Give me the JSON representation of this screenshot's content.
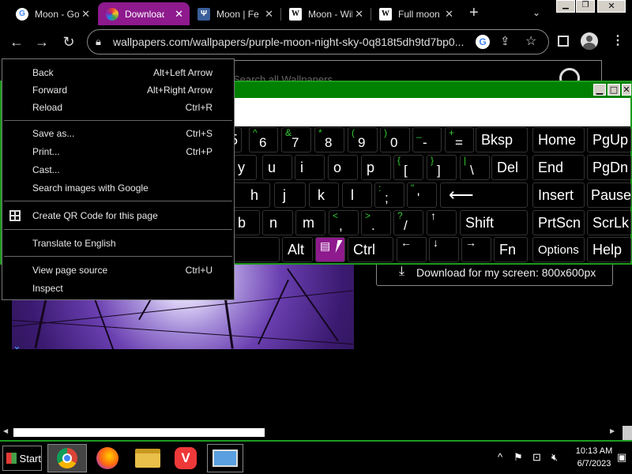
{
  "tabs": [
    {
      "title": "Moon - Google",
      "favicon": "google-icon",
      "active": false
    },
    {
      "title": "Download",
      "favicon": "wallpapers-icon",
      "active": true
    },
    {
      "title": "Moon | Fen",
      "favicon": "trident-icon",
      "active": false
    },
    {
      "title": "Moon - Wikipedia",
      "favicon": "wikipedia-icon",
      "active": false
    },
    {
      "title": "Full moon",
      "favicon": "wikipedia-icon",
      "active": false
    }
  ],
  "toolbar": {
    "url": "wallpapers.com/wallpapers/purple-moon-night-sky-0q818t5dh9td7bp0..."
  },
  "page": {
    "search_placeholder": "Search all Wallpapers",
    "download_label": "Download for my screen: 800x600px"
  },
  "osk": {
    "rows": [
      [
        {
          "shift": "^",
          "main": "6"
        },
        {
          "shift": "&",
          "main": "7"
        },
        {
          "shift": "*",
          "main": "8"
        },
        {
          "shift": "(",
          "main": "9"
        },
        {
          "shift": ")",
          "main": "0"
        },
        {
          "shift": "_",
          "main": "-"
        },
        {
          "shift": "+",
          "main": "="
        }
      ],
      [
        {
          "main": "y"
        },
        {
          "main": "u"
        },
        {
          "main": "i"
        },
        {
          "main": "o"
        },
        {
          "main": "p"
        },
        {
          "shift": "{",
          "main": "["
        },
        {
          "shift": "}",
          "main": "]"
        },
        {
          "shift": "|",
          "main": "\\"
        }
      ],
      [
        {
          "main": "h"
        },
        {
          "main": "j"
        },
        {
          "main": "k"
        },
        {
          "main": "l"
        },
        {
          "shift": ":",
          "main": ";"
        },
        {
          "shift": "\"",
          "main": "'"
        }
      ],
      [
        {
          "main": "b"
        },
        {
          "main": "n"
        },
        {
          "main": "m"
        },
        {
          "shift": "<",
          "main": ","
        },
        {
          "shift": ">",
          "main": "."
        },
        {
          "shift": "?",
          "main": "/"
        }
      ]
    ],
    "keys": {
      "partial_5": "5",
      "bksp": "Bksp",
      "del": "Del",
      "home": "Home",
      "pgup": "PgUp",
      "end": "End",
      "pgdn": "PgDn",
      "insert": "Insert",
      "pause": "Pause",
      "shift": "Shift",
      "prtscn": "PrtScn",
      "scrlk": "ScrLk",
      "alt": "Alt",
      "ctrl": "Ctrl",
      "fn": "Fn",
      "options": "Options",
      "help": "Help",
      "enter_arrow": "⟵",
      "up_arrow": "↑",
      "left_arrow": "←",
      "down_arrow": "↓",
      "right_arrow": "→",
      "menu_icon": "▤"
    }
  },
  "context_menu": {
    "items": [
      {
        "label": "Back",
        "shortcut": "Alt+Left Arrow"
      },
      {
        "label": "Forward",
        "shortcut": "Alt+Right Arrow"
      },
      {
        "label": "Reload",
        "shortcut": "Ctrl+R"
      },
      {
        "label": "Save as...",
        "shortcut": "Ctrl+S"
      },
      {
        "label": "Print...",
        "shortcut": "Ctrl+P"
      },
      {
        "label": "Cast...",
        "shortcut": ""
      },
      {
        "label": "Search images with Google",
        "shortcut": ""
      },
      {
        "label": "Create QR Code for this page",
        "shortcut": ""
      },
      {
        "label": "Translate to English",
        "shortcut": ""
      },
      {
        "label": "View page source",
        "shortcut": "Ctrl+U"
      },
      {
        "label": "Inspect",
        "shortcut": ""
      }
    ]
  },
  "taskbar": {
    "start_label": "Start",
    "apps": [
      "chrome-icon",
      "firefox-icon",
      "file-manager-icon",
      "vivaldi-icon",
      "remote-desktop-icon"
    ],
    "time": "10:13 AM",
    "date": "6/7/2023"
  },
  "colors": {
    "accent_tab": "#8e1a8e",
    "osk_border": "#1f9b1f",
    "osk_shift_text": "#33cc33"
  }
}
